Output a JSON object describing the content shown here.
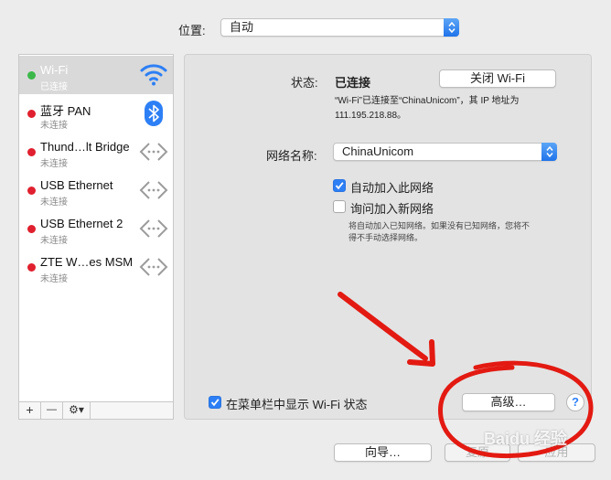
{
  "location": {
    "label": "位置:",
    "value": "自动"
  },
  "networks": [
    {
      "name": "Wi-Fi",
      "status": "已连接",
      "dot": "#3cb84a",
      "icon": "wifi-icon",
      "selected": true
    },
    {
      "name": "蓝牙 PAN",
      "status": "未连接",
      "dot": "#e0202f",
      "icon": "bluetooth-icon"
    },
    {
      "name": "Thund…lt Bridge",
      "status": "未连接",
      "dot": "#e0202f",
      "icon": "ethernet-icon"
    },
    {
      "name": "USB Ethernet",
      "status": "未连接",
      "dot": "#e0202f",
      "icon": "ethernet-icon"
    },
    {
      "name": "USB Ethernet 2",
      "status": "未连接",
      "dot": "#e0202f",
      "icon": "ethernet-icon"
    },
    {
      "name": "ZTE W…es MSM",
      "status": "未连接",
      "dot": "#e0202f",
      "icon": "ethernet-icon"
    }
  ],
  "toolbar": {
    "add": "+",
    "remove": "—",
    "action": "⚙▾"
  },
  "status": {
    "label": "状态:",
    "value": "已连接",
    "button": "关闭 Wi-Fi",
    "detail_line1": "“Wi-Fi”已连接至“ChinaUnicom”，其 IP 地址为",
    "detail_line2": "111.195.218.88。"
  },
  "network_name": {
    "label": "网络名称:",
    "value": "ChinaUnicom"
  },
  "options": {
    "auto_join": {
      "label": "自动加入此网络",
      "checked": true
    },
    "ask_join": {
      "label": "询问加入新网络",
      "checked": false
    },
    "hint_line1": "将自动加入已知网络。如果没有已知网络，您将不",
    "hint_line2": "得不手动选择网络。"
  },
  "menubar_option": {
    "label": "在菜单栏中显示 Wi-Fi 状态",
    "checked": true
  },
  "buttons": {
    "advanced": "高级…",
    "help": "?",
    "assist": "向导…",
    "revert": "复原",
    "apply": "应用"
  },
  "watermark": "Baidu 经验",
  "colors": {
    "accent": "#2d7ff5",
    "connected": "#3cb84a",
    "disconnected": "#e0202f",
    "annotation": "#e31a12"
  }
}
